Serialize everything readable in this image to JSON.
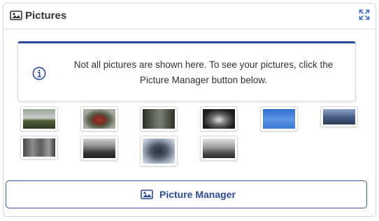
{
  "panel": {
    "title": "Pictures",
    "title_icon": "image-icon",
    "expand_icon": "expand-icon"
  },
  "notice": {
    "icon": "info-icon",
    "text": "Not all pictures are shown here. To see your pictures, click the Picture Manager button below."
  },
  "thumbnails": [
    {
      "name": "thumbnail-road-trees",
      "bg": "linear-gradient(#9aa39a 0%, #c9cfc6 45%, #4f5d3a 60%, #2d3a22 100%)"
    },
    {
      "name": "thumbnail-red-barn",
      "bg": "radial-gradient(ellipse at 50% 55%, #9b3b2c 0%, #7d2b20 25%, #55604a 45%, #a7aaa0 75%)"
    },
    {
      "name": "thumbnail-forest-road",
      "bg": "linear-gradient(90deg, #2a2e26 0%, #6f746a 45%, #7b7e75 55%, #2c3128 100%)"
    },
    {
      "name": "thumbnail-coca-cola-sign",
      "bg": "radial-gradient(ellipse at 50% 55%, #e0e0e0 0%, #6a6a6a 35%, #1e1e1e 70%)"
    },
    {
      "name": "thumbnail-flag",
      "bg": "linear-gradient(#2d6ed1 0%, #5e94e3 50%, #3a7ad6 100%)"
    },
    {
      "name": "thumbnail-street-lamps",
      "bg": "linear-gradient(#8ea5c9 0%, #4a5f86 50%, #2c3a58 100%)"
    },
    {
      "name": "thumbnail-monument",
      "bg": "linear-gradient(90deg, #494949 0%, #8b8b8b 30%, #5d5d5d 55%, #9a9a9a 80%, #3e3e3e 100%)"
    },
    {
      "name": "thumbnail-landscape-bw",
      "bg": "linear-gradient(#d0d0d0 0%, #8d8d8d 40%, #3b3b3b 70%, #1f1f1f 100%)"
    },
    {
      "name": "thumbnail-person",
      "bg": "radial-gradient(ellipse at 50% 50%, #2a2f3a 0%, #4a5566 35%, #a3b0be 70%, #e6e8ec 100%)"
    },
    {
      "name": "thumbnail-building-bw",
      "bg": "linear-gradient(#e4e4e4 0%, #9c9c9c 45%, #4e4e4e 75%, #2a2a2a 100%)"
    }
  ],
  "button": {
    "label": "Picture Manager",
    "icon": "image-icon"
  },
  "colors": {
    "accent": "#2a4aa0",
    "border": "#d9d9d9"
  }
}
